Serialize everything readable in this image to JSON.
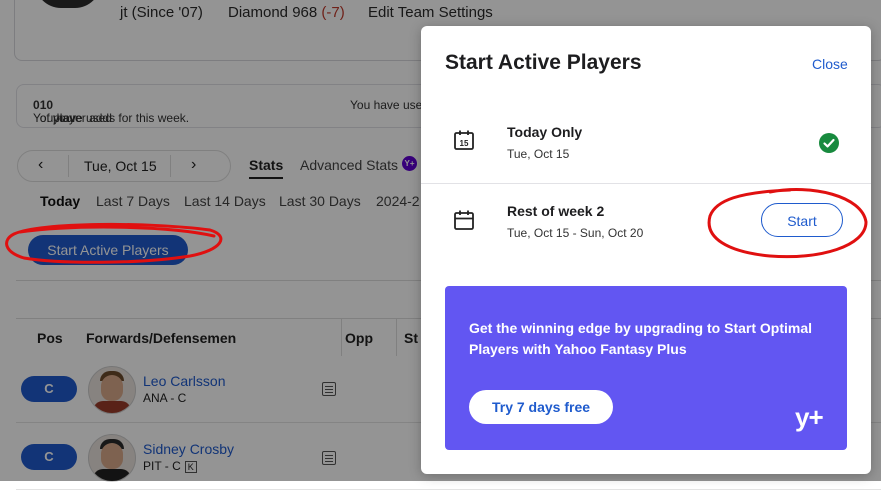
{
  "team": {
    "owner": "jt (Since '07)",
    "rank": "Diamond 968",
    "rank_change": "(-7)",
    "edit_link": "Edit Team Settings"
  },
  "notice": {
    "text_prefix": "You have used ",
    "used": "0",
    "text_mid": " of your ",
    "limit": "10",
    "text_suffix": " player adds for this week.",
    "text_second": "You have use"
  },
  "date_nav": {
    "date": "Tue, Oct 15",
    "prev": "‹",
    "next": "›"
  },
  "tabs": {
    "stats": "Stats",
    "advanced": "Advanced Stats",
    "advanced_badge": "Y+"
  },
  "periods": [
    "Today",
    "Last 7 Days",
    "Last 14 Days",
    "Last 30 Days",
    "2024-2"
  ],
  "start_active_button": "Start Active Players",
  "table": {
    "headers": [
      "Pos",
      "Forwards/Defensemen",
      "Opp",
      "St"
    ],
    "rows": [
      {
        "pos": "C",
        "name": "Leo Carlsson",
        "team": "ANA - C",
        "badge": ""
      },
      {
        "pos": "C",
        "name": "Sidney Crosby",
        "team": "PIT - C",
        "badge": "K"
      }
    ]
  },
  "modal": {
    "title": "Start Active Players",
    "close": "Close",
    "options": [
      {
        "title": "Today Only",
        "subtitle": "Tue, Oct 15",
        "icon": "calendar-15-icon",
        "status": "selected"
      },
      {
        "title": "Rest of week 2",
        "subtitle": "Tue, Oct 15 - Sun, Oct 20",
        "icon": "calendar-icon",
        "action": "Start"
      }
    ],
    "promo": {
      "text": "Get the winning edge by upgrading to Start Optimal Players with Yahoo Fantasy Plus",
      "button": "Try 7 days free",
      "logo": "y+"
    }
  },
  "colors": {
    "accent": "#1f5bcd",
    "promo_bg": "#6256f2",
    "success": "#188a3e",
    "annotation": "#e01010"
  }
}
